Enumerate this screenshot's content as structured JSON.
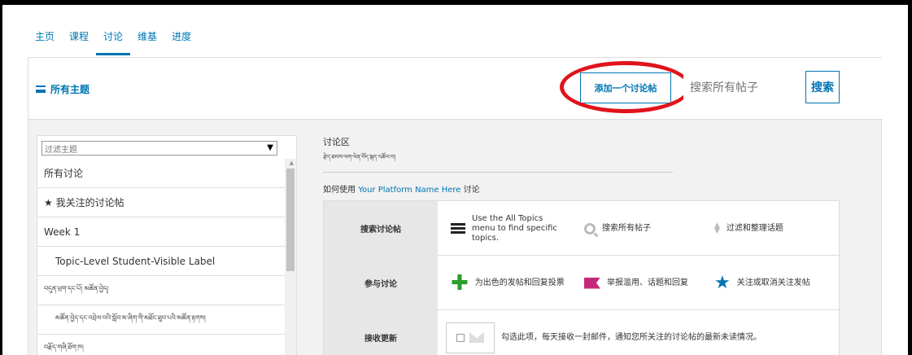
{
  "tabs": [
    "主页",
    "课程",
    "讨论",
    "维基",
    "进度"
  ],
  "active_tab": 2,
  "header": {
    "all_topics": "所有主题",
    "add_post": "添加一个讨论帖",
    "search_placeholder": "搜索所有帖子",
    "search_button": "搜索"
  },
  "sidebar": {
    "filter_placeholder": "过滤主题",
    "items": [
      "所有讨论",
      "★ 我关注的讨论帖",
      "Week 1",
      "Topic-Level Student-Visible Label",
      "བདུན་ཕྲག་དང་པོ། མཚོན་བྱེད།",
      "མཚོན་བྱེད་དང་འབྲེལ་བའི་སློབ་མ་ཞིག་གི་མཐོང་ཐུབ་པའི་མཚོན་རྟགས།",
      "བརྗོད་གཞི་ཐོག་ཁ།"
    ]
  },
  "main": {
    "zone_title": "讨论区",
    "zone_subtitle": "རྩེད་ཐབས་ལག་ལེན་བོད་སྐད་འཚོལ་བ།",
    "how_to_prefix": "如何使用 ",
    "platform_name": "Your Platform Name Here",
    "how_to_suffix": " 讨论",
    "rows": [
      {
        "label": "搜索讨论帖",
        "cells": [
          {
            "icon": "menu-icon",
            "text": "Use the All Topics menu to find specific topics."
          },
          {
            "icon": "search-icon",
            "text": "搜索所有帖子"
          },
          {
            "icon": "sort-icon",
            "text": "过滤和整理话题"
          }
        ]
      },
      {
        "label": "参与讨论",
        "cells": [
          {
            "icon": "plus-icon",
            "text": "为出色的发帖和回复投票"
          },
          {
            "icon": "flag-icon",
            "text": "举报滥用、话题和回复"
          },
          {
            "icon": "star-icon",
            "text": "关注或取消关注发帖"
          }
        ]
      },
      {
        "label": "接收更新",
        "cells": [
          {
            "icon": "email-icon",
            "text": "勾选此项，每天接收一封邮件，通知您所关注的讨论帖的最新未读情况。"
          }
        ]
      }
    ]
  },
  "colors": {
    "accent": "#0075b4",
    "highlight_ring": "#e0131b"
  }
}
